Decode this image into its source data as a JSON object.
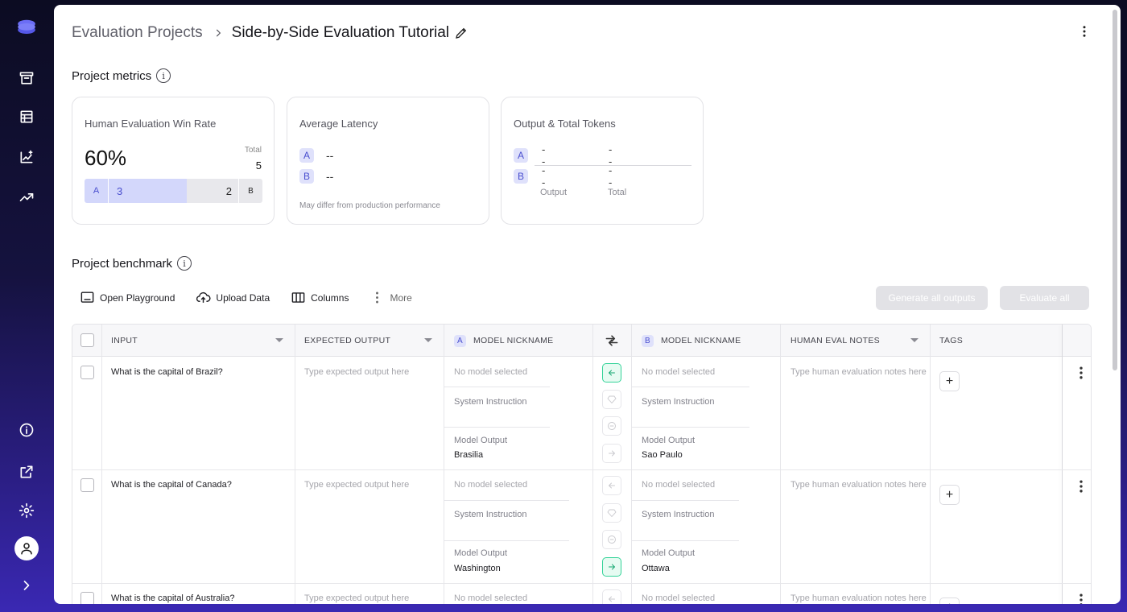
{
  "breadcrumb": {
    "root": "Evaluation Projects",
    "current": "Side-by-Side Evaluation Tutorial"
  },
  "metrics": {
    "title": "Project metrics",
    "win_rate": {
      "title": "Human Evaluation Win Rate",
      "value": "60%",
      "total_label": "Total",
      "total": "5",
      "a_label": "A",
      "a_wins": "3",
      "b_wins": "2",
      "b_label": "B",
      "a_fraction": 0.6
    },
    "latency": {
      "title": "Average Latency",
      "a_label": "A",
      "a_value": "--",
      "b_label": "B",
      "b_value": "--",
      "note": "May differ from production performance"
    },
    "tokens": {
      "title": "Output & Total Tokens",
      "a_label": "A",
      "a_output": "--",
      "a_total": "--",
      "b_label": "B",
      "b_output": "--",
      "b_total": "--",
      "output_label": "Output",
      "total_label": "Total"
    }
  },
  "benchmark": {
    "title": "Project benchmark",
    "toolbar": {
      "playground": "Open Playground",
      "upload": "Upload Data",
      "columns": "Columns",
      "more": "More",
      "generate_all": "Generate all outputs",
      "evaluate_all": "Evaluate all"
    },
    "columns": {
      "input": "INPUT",
      "expected": "EXPECTED OUTPUT",
      "a_badge": "A",
      "model_a": "MODEL NICKNAME",
      "b_badge": "B",
      "model_b": "MODEL NICKNAME",
      "notes": "HUMAN EVAL NOTES",
      "tags": "TAGS"
    },
    "placeholders": {
      "expected": "Type expected output here",
      "notes": "Type human evaluation notes here"
    },
    "labels": {
      "no_model": "No model selected",
      "system_instruction": "System Instruction",
      "model_output": "Model Output"
    },
    "rows": [
      {
        "input": "What is the capital of Brazil?",
        "output_a": "Brasilia",
        "output_b": "Sao Paulo",
        "vote": "A"
      },
      {
        "input": "What is the capital of Canada?",
        "output_a": "Washington",
        "output_b": "Ottawa",
        "vote": "B"
      },
      {
        "input": "What is the capital of Australia?",
        "output_a": "",
        "output_b": "",
        "vote": ""
      }
    ]
  }
}
